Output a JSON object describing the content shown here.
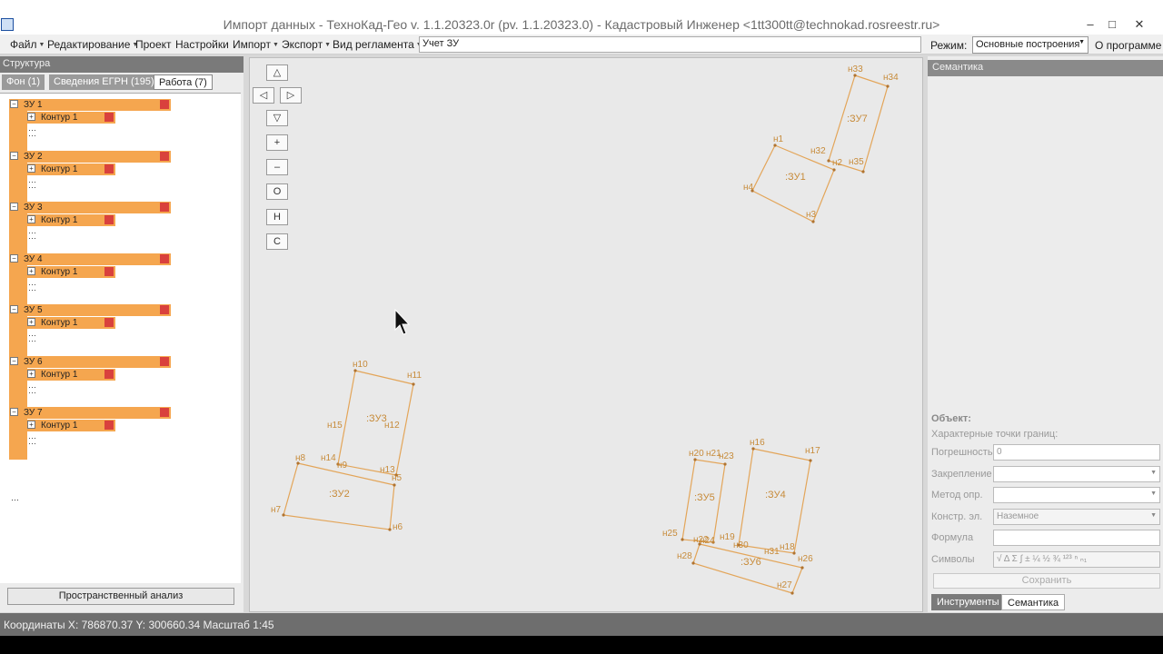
{
  "window": {
    "title": "Импорт данных - ТехноКад-Гео v. 1.1.20323.0r (pv. 1.1.20323.0) - Кадастровый Инженер <1tt300tt@technokad.rosreestr.ru>",
    "minimize": "–",
    "maximize": "□",
    "close": "✕"
  },
  "menu": {
    "file": "Файл",
    "edit": "Редактирование",
    "project": "Проект",
    "settings": "Настройки",
    "import": "Импорт",
    "export": "Экспорт",
    "reglament": "Вид регламента",
    "reglament_value": "Учет ЗУ",
    "mode_label": "Режим:",
    "mode_value": "Основные построения",
    "about": "О программе"
  },
  "structure": {
    "header": "Структура",
    "tabs": [
      {
        "label": "Фон (1)",
        "active": false
      },
      {
        "label": "Сведения ЕГРН (195)",
        "active": false
      },
      {
        "label": "Работа (7)",
        "active": true
      }
    ],
    "items": [
      {
        "label": "ЗУ 1",
        "contour": "Контур 1"
      },
      {
        "label": "ЗУ 2",
        "contour": "Контур 1"
      },
      {
        "label": "ЗУ 3",
        "contour": "Контур 1"
      },
      {
        "label": "ЗУ 4",
        "contour": "Контур 1"
      },
      {
        "label": "ЗУ 5",
        "contour": "Контур 1"
      },
      {
        "label": "ЗУ 6",
        "contour": "Контур 1"
      },
      {
        "label": "ЗУ 7",
        "contour": "Контур 1"
      }
    ],
    "spatial_analysis_button": "Пространственный анализ"
  },
  "nav": {
    "up": "△",
    "left": "◁",
    "right": "▷",
    "down": "▽",
    "zoom_in": "+",
    "zoom_out": "–",
    "btn_o": "О",
    "btn_h": "Н",
    "btn_c": "С"
  },
  "map": {
    "parcels": [
      {
        "label": ":ЗУ1"
      },
      {
        "label": ":ЗУ7"
      },
      {
        "label": ":ЗУ3"
      },
      {
        "label": ":ЗУ2"
      },
      {
        "label": ":ЗУ5"
      },
      {
        "label": ":ЗУ4"
      },
      {
        "label": ":ЗУ6"
      }
    ],
    "points": [
      "н33",
      "н34",
      "н1",
      "н32",
      "н2",
      "н35",
      "н4",
      "н3",
      "н10",
      "н11",
      "н15",
      "н12",
      "н8",
      "н14",
      "н9",
      "н13",
      "н5",
      "н7",
      "н6",
      "н20",
      "н21",
      "н23",
      "н16",
      "н17",
      "н25",
      "н22",
      "н24",
      "н19",
      "н30",
      "н31",
      "н18",
      "н28",
      "н26",
      "н27"
    ]
  },
  "semantics": {
    "header": "Семантика",
    "object_title": "Объект:",
    "char_points": "Характерные точки границ:",
    "fields": [
      {
        "label": "Погрешность",
        "value": "0",
        "dropdown": false,
        "disabled": false
      },
      {
        "label": "Закрепление",
        "value": "",
        "dropdown": true,
        "disabled": false
      },
      {
        "label": "Метод опр.",
        "value": "",
        "dropdown": true,
        "disabled": false
      },
      {
        "label": "Констр. эл.",
        "value": "Наземное",
        "dropdown": true,
        "disabled": true
      },
      {
        "label": "Формула",
        "value": "",
        "dropdown": false,
        "disabled": false
      },
      {
        "label": "Символы",
        "value": "√ Δ Σ ∫ ± ¼ ½ ¾ ¹²³ ⁿ ₙ₁",
        "dropdown": false,
        "disabled": true
      }
    ],
    "save_button": "Сохранить",
    "tabs": [
      {
        "label": "Инструменты",
        "active": true
      },
      {
        "label": "Семантика",
        "active": false
      }
    ]
  },
  "status": {
    "text": "Координаты  X: 786870.37 Y: 300660.34  Масштаб 1:45"
  },
  "colors": {
    "parcel_stroke": "#e3a559",
    "tree_highlight": "#f5a64f",
    "tree_marker": "#d9413d",
    "status_bg": "#6e6e6e"
  }
}
